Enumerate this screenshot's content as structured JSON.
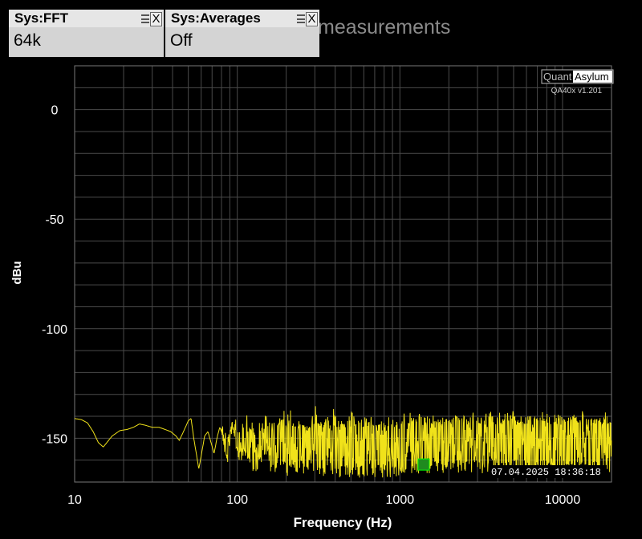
{
  "widgets": [
    {
      "title": "Sys:FFT",
      "value": "64k"
    },
    {
      "title": "Sys:Averages",
      "value": "Off"
    }
  ],
  "background_title": "measurements",
  "logo": {
    "part1": "Quant",
    "part2": "Asylum",
    "version": "QA40x v1.201"
  },
  "timestamp": "07.04.2025 18:36:18",
  "colors": {
    "trace": "#f0e21a",
    "grid": "#4a4a4a",
    "marker": "#1f8a1f",
    "background": "#000000"
  },
  "icons": [
    "menu-icon",
    "close-icon"
  ],
  "chart_data": {
    "type": "line",
    "title": "",
    "xlabel": "Frequency (Hz)",
    "ylabel": "dBu",
    "x_scale": "log",
    "xlim": [
      10,
      20000
    ],
    "ylim": [
      -170,
      20
    ],
    "x_ticks": [
      "10",
      "100",
      "1000",
      "10000"
    ],
    "y_ticks": [
      "0",
      "-50",
      "-100",
      "-150"
    ],
    "grid": true,
    "series": [
      {
        "x": [
          10,
          11,
          12,
          13,
          14,
          15,
          17,
          19,
          21,
          23,
          25,
          27,
          30,
          33,
          36,
          39,
          42,
          44,
          46,
          48,
          50,
          52,
          54,
          56,
          58,
          60,
          63,
          66,
          69,
          72,
          75,
          78,
          81,
          84,
          87,
          90,
          93,
          96,
          100,
          110,
          120,
          130,
          140,
          150,
          160,
          170,
          180,
          190,
          200,
          220,
          240,
          260,
          280,
          300,
          330,
          360,
          400,
          450,
          500,
          600,
          700,
          800,
          900,
          1000,
          1200,
          1400,
          1600,
          2000,
          2500,
          3000,
          4000,
          5000,
          6000,
          8000,
          10000,
          12000,
          15000,
          20000
        ],
        "y": [
          -141,
          -141.5,
          -143,
          -147,
          -152,
          -154,
          -149,
          -146.5,
          -146,
          -145,
          -143.5,
          -144,
          -145,
          -145,
          -146,
          -147,
          -149,
          -151,
          -148,
          -145,
          -142,
          -141,
          -150,
          -157,
          -164,
          -158,
          -149,
          -147,
          -152,
          -157,
          -150,
          -145,
          -148,
          -152,
          -156,
          -148,
          -145,
          -146,
          -150,
          -147,
          -151,
          -156,
          -150,
          -147,
          -149,
          -155,
          -150,
          -146,
          -152,
          -148,
          -150,
          -155,
          -149,
          -147,
          -151,
          -149,
          -150,
          -152,
          -150,
          -151,
          -152,
          -152,
          -151,
          -152,
          -152,
          -152,
          -151,
          -151,
          -151,
          -150,
          -151,
          -150,
          -151,
          -150,
          -150,
          -150,
          -151,
          -150
        ],
        "noise_floor_min": [
          -142,
          -142,
          -144,
          -148,
          -153,
          -155,
          -150,
          -147,
          -147,
          -146,
          -145,
          -145,
          -146,
          -146,
          -147,
          -149,
          -151,
          -152,
          -150,
          -146,
          -143,
          -142,
          -153,
          -160,
          -166,
          -162,
          -152,
          -150,
          -156,
          -162,
          -154,
          -149,
          -154,
          -158,
          -162,
          -154,
          -151,
          -153,
          -160,
          -160,
          -166,
          -166,
          -162,
          -160,
          -165,
          -168,
          -164,
          -163,
          -168,
          -166,
          -168,
          -168,
          -166,
          -168,
          -168,
          -168,
          -168,
          -168,
          -168,
          -168,
          -168,
          -168,
          -168,
          -168,
          -168,
          -166,
          -166,
          -166,
          -166,
          -166,
          -166,
          -166,
          -166,
          -166,
          -166,
          -166,
          -166,
          -166
        ],
        "noise_floor_max": [
          -141,
          -141,
          -142,
          -146,
          -151,
          -153,
          -148,
          -146,
          -145,
          -144,
          -143,
          -143,
          -144,
          -144,
          -145,
          -146,
          -148,
          -150,
          -146,
          -143,
          -140,
          -140,
          -146,
          -152,
          -158,
          -154,
          -146,
          -144,
          -148,
          -152,
          -146,
          -142,
          -144,
          -147,
          -150,
          -144,
          -142,
          -142,
          -145,
          -142,
          -144,
          -145,
          -143,
          -142,
          -142,
          -143,
          -142,
          -141,
          -143,
          -142,
          -143,
          -144,
          -142,
          -141,
          -142,
          -142,
          -141,
          -142,
          -141,
          -142,
          -142,
          -142,
          -141,
          -141,
          -140,
          -140,
          -140,
          -140,
          -140,
          -140,
          -140,
          -140,
          -140,
          -140,
          -140,
          -140,
          -140,
          -140
        ]
      }
    ],
    "marker": {
      "x": 1400,
      "y": -162
    }
  }
}
